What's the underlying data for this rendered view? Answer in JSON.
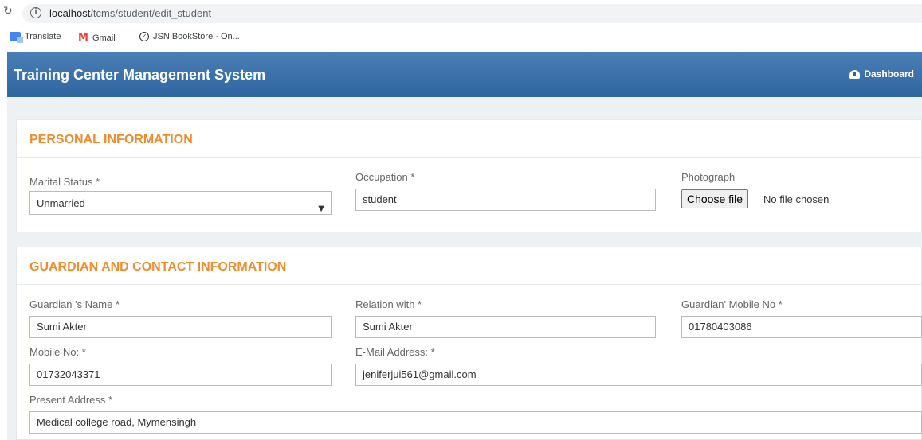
{
  "browser": {
    "url_host": "localhost",
    "url_path": "/tcms/student/edit_student",
    "bookmarks": [
      "Translate",
      "Gmail",
      "JSN BookStore - On..."
    ]
  },
  "navbar": {
    "brand": "Training Center Management System",
    "dashboard_label": "Dashboard"
  },
  "personal": {
    "title": "PERSONAL INFORMATION",
    "marital_label": "Marital Status *",
    "marital_value": "Unmarried",
    "occupation_label": "Occupation *",
    "occupation_value": "student",
    "photo_label": "Photograph",
    "file_button": "Choose file",
    "file_status": "No file chosen"
  },
  "guardian": {
    "title": "GUARDIAN AND CONTACT INFORMATION",
    "guardian_name_label": "Guardian 's Name *",
    "guardian_name_value": "Sumi Akter",
    "relation_label": "Relation with *",
    "relation_value": "Sumi Akter",
    "guardian_mobile_label": "Guardian' Mobile No *",
    "guardian_mobile_value": "01780403086",
    "mobile_label": "Mobile No: *",
    "mobile_value": "01732043371",
    "email_label": "E-Mail Address: *",
    "email_value": "jeniferjui561@gmail.com",
    "address_label": "Present Address *",
    "address_value": "Medical college road, Mymensingh"
  }
}
